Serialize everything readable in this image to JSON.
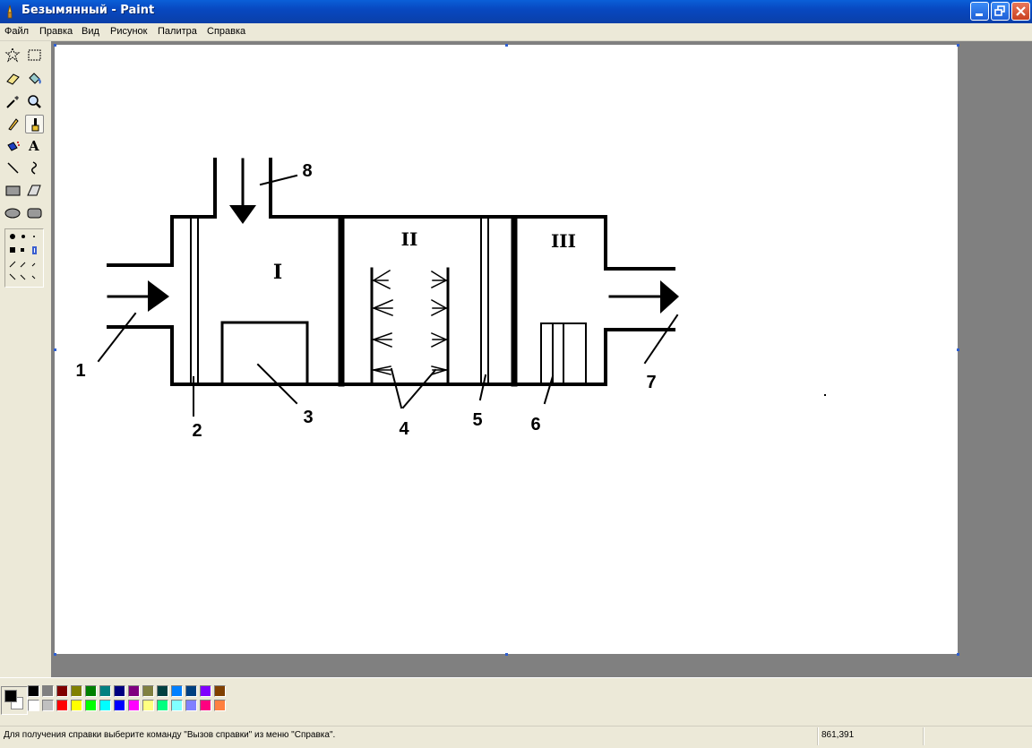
{
  "window": {
    "title": "Безымянный - Paint",
    "icon": "paint-app-icon"
  },
  "window_controls": [
    "minimize-icon",
    "restore-icon",
    "close-icon"
  ],
  "menu": [
    "Файл",
    "Правка",
    "Вид",
    "Рисунок",
    "Палитра",
    "Справка"
  ],
  "tools": [
    {
      "name": "free-select",
      "icon": "star-select-icon"
    },
    {
      "name": "select",
      "icon": "rect-select-icon"
    },
    {
      "name": "eraser",
      "icon": "eraser-icon"
    },
    {
      "name": "fill",
      "icon": "paint-bucket-icon"
    },
    {
      "name": "pick-color",
      "icon": "eyedropper-icon"
    },
    {
      "name": "magnifier",
      "icon": "magnifier-icon"
    },
    {
      "name": "pencil",
      "icon": "pencil-icon"
    },
    {
      "name": "brush",
      "icon": "brush-icon",
      "active": true
    },
    {
      "name": "airbrush",
      "icon": "airbrush-icon"
    },
    {
      "name": "text",
      "icon": "text-icon",
      "glyph": "A"
    },
    {
      "name": "line",
      "icon": "line-icon"
    },
    {
      "name": "curve",
      "icon": "curve-icon"
    },
    {
      "name": "rectangle",
      "icon": "rectangle-icon"
    },
    {
      "name": "polygon",
      "icon": "polygon-icon"
    },
    {
      "name": "ellipse",
      "icon": "ellipse-icon"
    },
    {
      "name": "rounded-rect",
      "icon": "rounded-rect-icon"
    }
  ],
  "drawing": {
    "zones": [
      "I",
      "II",
      "III"
    ],
    "labels": [
      "1",
      "2",
      "3",
      "4",
      "5",
      "6",
      "7",
      "8"
    ]
  },
  "colors": {
    "foreground": "#000000",
    "background": "#ffffff",
    "palette_top": [
      "#000000",
      "#808080",
      "#800000",
      "#808000",
      "#008000",
      "#008080",
      "#000080",
      "#800080",
      "#808040",
      "#004040",
      "#0080ff",
      "#004080",
      "#8000ff",
      "#804000"
    ],
    "palette_bottom": [
      "#ffffff",
      "#c0c0c0",
      "#ff0000",
      "#ffff00",
      "#00ff00",
      "#00ffff",
      "#0000ff",
      "#ff00ff",
      "#ffff80",
      "#00ff80",
      "#80ffff",
      "#8080ff",
      "#ff0080",
      "#ff8040"
    ]
  },
  "status": {
    "message": "Для получения справки выберите команду \"Вызов справки\" из меню \"Справка\".",
    "coords": "861,391"
  }
}
